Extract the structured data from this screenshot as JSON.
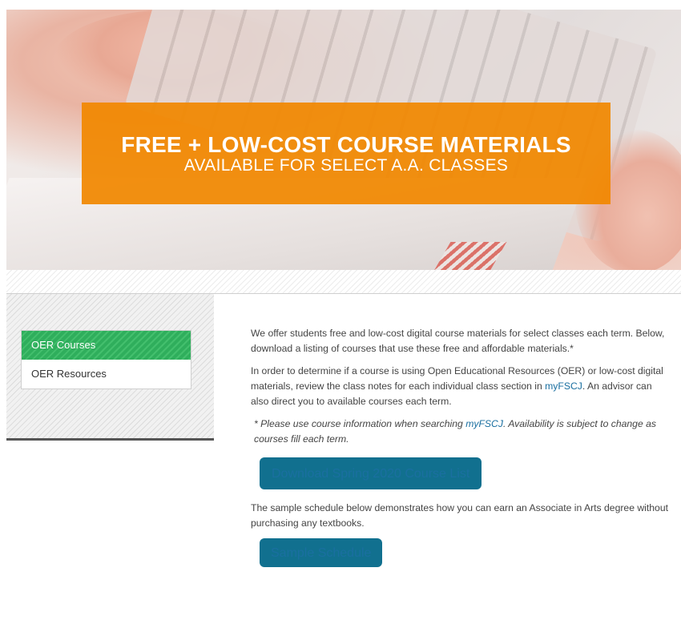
{
  "hero": {
    "title": "FREE + LOW-COST COURSE MATERIALS",
    "subtitle": "AVAILABLE FOR SELECT A.A. CLASSES"
  },
  "sidebar": {
    "items": [
      {
        "label": "OER Courses",
        "active": true
      },
      {
        "label": "OER Resources",
        "active": false
      }
    ]
  },
  "content": {
    "intro": "We offer students free and low-cost digital course materials for select classes each term. Below, download a listing of courses that use these free and affordable materials.*",
    "determine_pre": "In order to determine if a course is using Open Educational Resources (OER) or low-cost digital materials, review the class notes for each individual class section in ",
    "determine_link": "myFSCJ",
    "determine_post": ". An advisor can also direct you to available courses each term.",
    "note_pre": "* Please use course information when searching ",
    "note_link": "myFSCJ",
    "note_post": ". Availability is subject to change as courses fill each term.",
    "download_button": "Download Spring 2020 Course List",
    "sample_text": "The sample schedule below demonstrates how you can earn an Associate in Arts degree without purchasing any textbooks.",
    "sample_button": "Sample Schedule"
  },
  "colors": {
    "banner": "#f18800",
    "active_nav": "#2fae5c",
    "button": "#11708f",
    "link": "#1a6fa0"
  }
}
